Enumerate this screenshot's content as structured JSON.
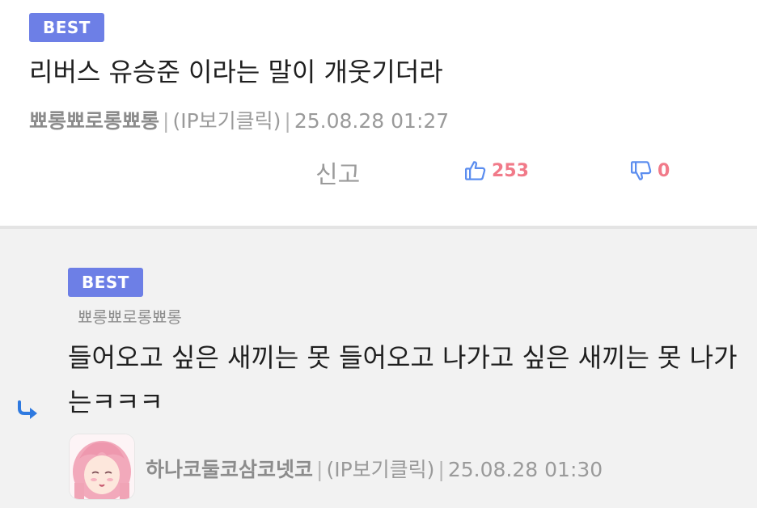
{
  "comment": {
    "badge": "BEST",
    "text": "리버스 유승준 이라는 말이 개웃기더라",
    "author": "뾰롱뾰로롱뾰롱",
    "ip_label": "(IP보기클릭)",
    "timestamp": "25.08.28 01:27",
    "report_label": "신고",
    "upvotes": "253",
    "downvotes": "0"
  },
  "reply": {
    "badge": "BEST",
    "reply_to": "뾰롱뾰로롱뾰롱",
    "text": "들어오고 싶은 새끼는 못 들어오고 나가고 싶은 새끼는 못 나가는ㅋㅋㅋ",
    "author": "하나코둘코삼코넷코",
    "ip_label": "(IP보기클릭)",
    "timestamp": "25.08.28 01:30"
  },
  "colors": {
    "badge": "#6d7fe6",
    "vote_count": "#f17a89",
    "vote_icon": "#5b8def",
    "reply_background": "#f2f2f2",
    "reply_arrow": "#2f7ae0"
  },
  "icons": {
    "upvote": "thumbs-up-icon",
    "downvote": "thumbs-down-icon",
    "reply": "reply-arrow-icon"
  }
}
